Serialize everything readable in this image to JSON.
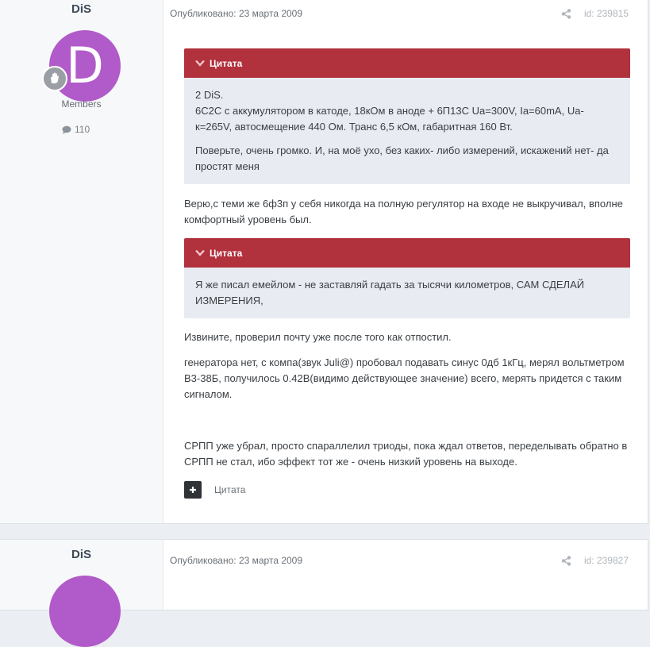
{
  "posts": [
    {
      "author": "DiS",
      "avatar_letter": "D",
      "group": "Members",
      "post_count": "110",
      "published": "Опубликовано: 23 марта 2009",
      "post_id": "id: 239815",
      "quotes": [
        {
          "header": "Цитата",
          "lines": [
            "2 DiS.\n6С2С с аккумулятором в катоде, 18кОм в аноде + 6П13С Ua=300V, Ia=60mA, Ua-к=265V, автосмещение 440 Ом. Транс 6,5 кОм, габаритная 160 Вт.",
            "Поверьте, очень громко. И, на моё ухо, без каких- либо измерений, искажений нет- да простят меня"
          ]
        },
        {
          "header": "Цитата",
          "lines": [
            "Я же писал емейлом - не заставляй гадать за тысячи километров, САМ СДЕЛАЙ ИЗМЕРЕНИЯ,"
          ]
        }
      ],
      "paragraphs": [
        "Верю,с теми же 6ф3п у себя никогда на полную регулятор на входе не выкручивал, вполне комфортный уровень был.",
        "Извините, проверил почту уже после того как отпостил.",
        "генератора нет, с компа(звук Juli@) пробовал подавать синус 0дб 1кГц, мерял вольтметром В3-38Б, получилось 0.42В(видимо действующее значение) всего, мерять придется с таким сигналом.",
        "СРПП уже убрал, просто спараллелил триоды, пока ждал ответов, переделывать обратно в СРПП не стал, ибо эффект тот же - очень низкий уровень на выходе."
      ],
      "quote_action": "Цитата"
    },
    {
      "author": "DiS",
      "published": "Опубликовано: 23 марта 2009",
      "post_id": "id: 239827"
    }
  ],
  "colors": {
    "quote_header": "#b1313c",
    "quote_bg": "#e8ebf1",
    "avatar": "#b15ac9"
  }
}
